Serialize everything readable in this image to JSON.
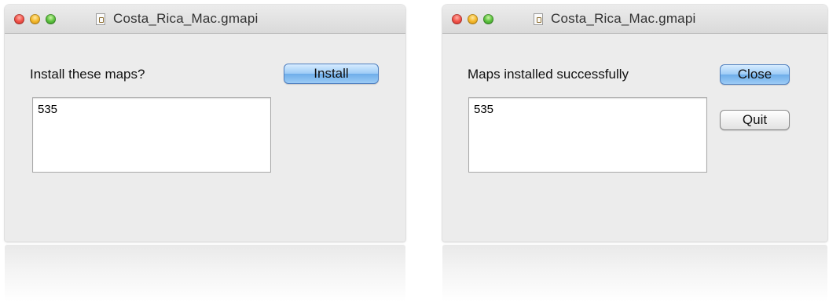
{
  "dialogs": [
    {
      "title": "Costa_Rica_Mac.gmapi",
      "prompt": "Install these maps?",
      "list_value": "535",
      "buttons": {
        "primary": "Install"
      }
    },
    {
      "title": "Costa_Rica_Mac.gmapi",
      "prompt": "Maps installed successfully",
      "list_value": "535",
      "buttons": {
        "primary": "Close",
        "secondary": "Quit"
      }
    }
  ],
  "icons": {
    "close": "red-close-button-icon",
    "minimize": "yellow-minimize-button-icon",
    "zoom": "green-zoom-button-icon",
    "document": "document-proxy-icon"
  },
  "colors": {
    "window_bg": "#ececec",
    "default_button": "#9dcbf6",
    "close_light": "#f2544b",
    "minimize_light": "#f4b82b",
    "zoom_light": "#5cc23f"
  }
}
